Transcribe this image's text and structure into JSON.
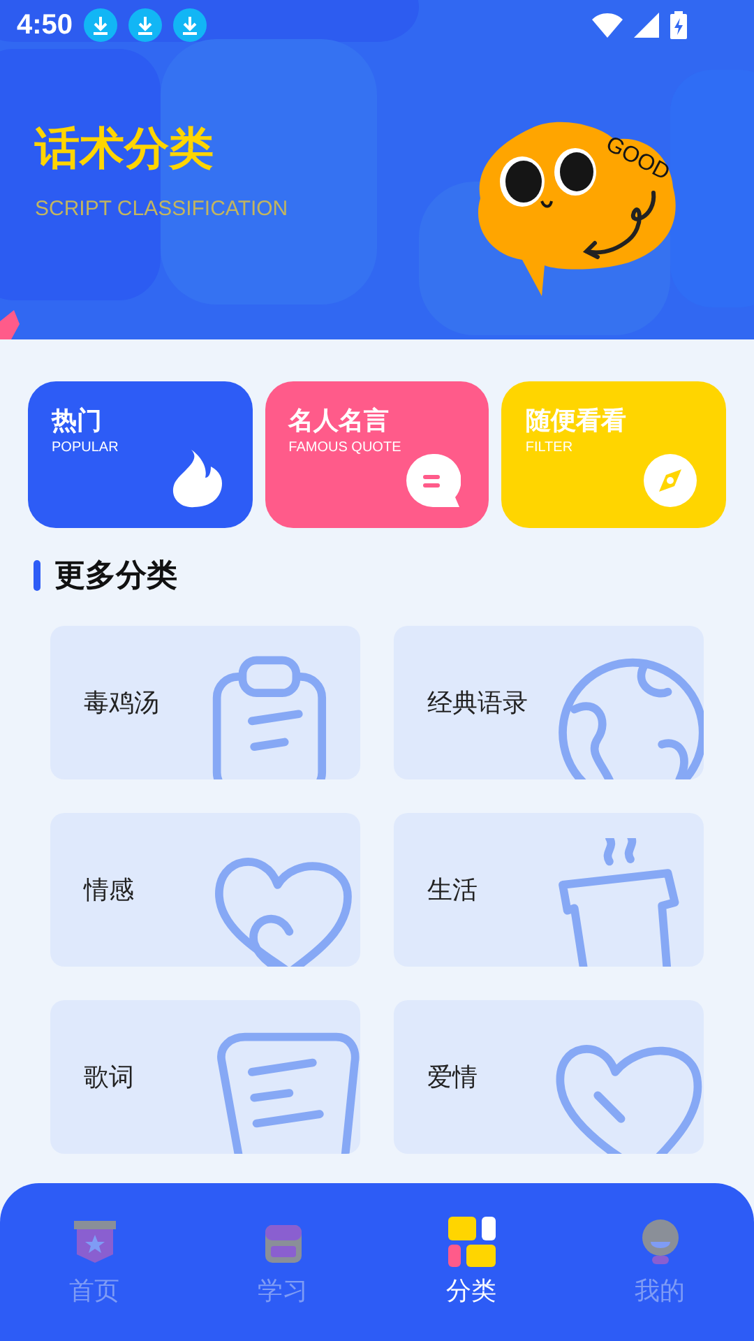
{
  "status_bar": {
    "time": "4:50"
  },
  "header": {
    "title": "话术分类",
    "subtitle": "SCRIPT CLASSIFICATION",
    "mascot_text": "GOOD"
  },
  "quick_cards": [
    {
      "title": "热门",
      "subtitle": "POPULAR",
      "kind": "flame",
      "color": "#2d5cf6"
    },
    {
      "title": "名人名言",
      "subtitle": "FAMOUS QUOTE",
      "kind": "chat",
      "color": "#ff5b8a"
    },
    {
      "title": "随便看看",
      "subtitle": "FILTER",
      "kind": "compass",
      "color": "#ffd500"
    }
  ],
  "section_title": "更多分类",
  "categories": [
    {
      "label": "毒鸡汤",
      "kind": "clipboard"
    },
    {
      "label": "经典语录",
      "kind": "globe"
    },
    {
      "label": "情感",
      "kind": "hearts"
    },
    {
      "label": "生活",
      "kind": "cup"
    },
    {
      "label": "歌词",
      "kind": "note"
    },
    {
      "label": "爱情",
      "kind": "heart"
    }
  ],
  "tabs": [
    {
      "label": "首页",
      "kind": "badge",
      "selected": false
    },
    {
      "label": "学习",
      "kind": "bag",
      "selected": false
    },
    {
      "label": "分类",
      "kind": "grid",
      "selected": true
    },
    {
      "label": "我的",
      "kind": "person",
      "selected": false
    }
  ]
}
